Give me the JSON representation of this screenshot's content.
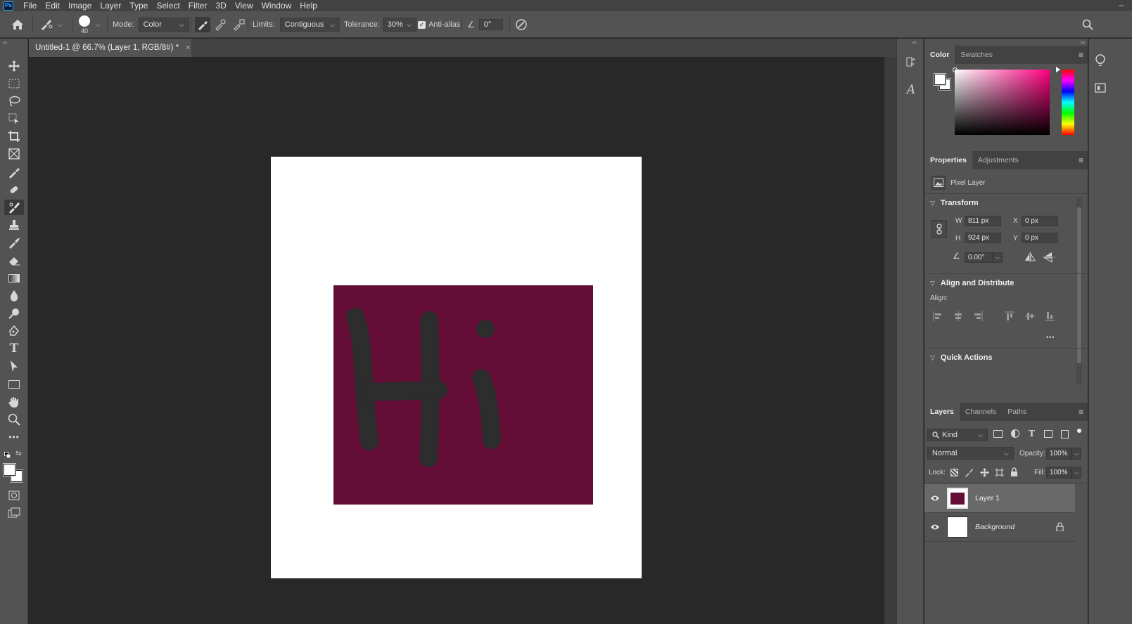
{
  "menubar": {
    "logo": "Ps",
    "items": [
      "File",
      "Edit",
      "Image",
      "Layer",
      "Type",
      "Select",
      "Filter",
      "3D",
      "View",
      "Window",
      "Help"
    ],
    "minimize": "–"
  },
  "options": {
    "brush_size": "40",
    "mode_label": "Mode:",
    "mode_value": "Color",
    "limits_label": "Limits:",
    "limits_value": "Contiguous",
    "tolerance_label": "Tolerance:",
    "tolerance_value": "30%",
    "antialias_label": "Anti-alias",
    "antialias_checked": true,
    "angle_value": "0°"
  },
  "document": {
    "tab_title": "Untitled-1 @ 66.7% (Layer 1, RGB/8#) *",
    "close": "×"
  },
  "colors": {
    "foreground": "#ffffff",
    "background": "#ffffff",
    "layer1_fill": "#640d36",
    "accent": "#31a8ff"
  },
  "color_panel": {
    "tabs": [
      "Color",
      "Swatches"
    ]
  },
  "properties_panel": {
    "tabs": [
      "Properties",
      "Adjustments"
    ],
    "layer_kind": "Pixel Layer",
    "transform_title": "Transform",
    "w_label": "W",
    "w_value": "811 px",
    "h_label": "H",
    "h_value": "924 px",
    "x_label": "X",
    "x_value": "0 px",
    "y_label": "Y",
    "y_value": "0 px",
    "angle_value": "0.00°",
    "align_title": "Align and Distribute",
    "align_label": "Align:",
    "more": "•••",
    "quick_actions_title": "Quick Actions"
  },
  "layers_panel": {
    "tabs": [
      "Layers",
      "Channels",
      "Paths"
    ],
    "filter_kind": "Kind",
    "blend_mode": "Normal",
    "opacity_label": "Opacity:",
    "opacity_value": "100%",
    "lock_label": "Lock:",
    "fill_label": "Fill:",
    "fill_value": "100%",
    "layers": [
      {
        "name": "Layer 1",
        "visible": true,
        "selected": true
      },
      {
        "name": "Background",
        "visible": true,
        "locked": true
      }
    ]
  }
}
